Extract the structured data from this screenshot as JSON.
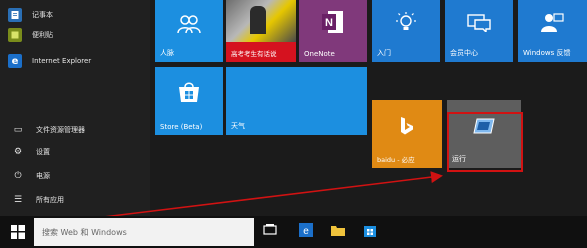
{
  "left_apps": [
    {
      "label": "记事本",
      "icon": "notepad-icon",
      "color": "#2a6fb5"
    },
    {
      "label": "便利贴",
      "icon": "sticky-notes-icon",
      "color": "#7a8c1b"
    },
    {
      "label": "Internet Explorer",
      "icon": "internet-explorer-icon",
      "color": "#1b6fc9"
    }
  ],
  "system_items": [
    {
      "label": "文件资源管理器",
      "icon": "folder-icon",
      "glyph": "▭"
    },
    {
      "label": "设置",
      "icon": "gear-icon",
      "glyph": "⚙"
    },
    {
      "label": "电源",
      "icon": "power-icon",
      "glyph": "⏻"
    },
    {
      "label": "所有应用",
      "icon": "all-apps-icon",
      "glyph": "☰"
    }
  ],
  "tiles": {
    "people": {
      "label": "人脉",
      "color": "#1c8fe0"
    },
    "news": {
      "label": "高考考生有话说",
      "color": "#d5121f"
    },
    "onenote": {
      "label": "OneNote",
      "color": "#80397b"
    },
    "getstarted": {
      "label": "入门",
      "color": "#1f7ad0"
    },
    "contact": {
      "label": "会员中心",
      "color": "#1f7ad0"
    },
    "feedback": {
      "label": "Windows 反馈",
      "color": "#1f7ad0"
    },
    "store": {
      "label": "Store (Beta)",
      "color": "#1c8fe0"
    },
    "weather": {
      "label": "天气",
      "color": "#1c8fe0"
    },
    "baidu": {
      "label": "baidu - 必应",
      "color": "#e08a14"
    },
    "run": {
      "label": "运行",
      "color": "#5e5e5e"
    }
  },
  "taskbar": {
    "search_placeholder": "搜索 Web 和 Windows"
  },
  "colors": {
    "highlight": "#d11212"
  }
}
